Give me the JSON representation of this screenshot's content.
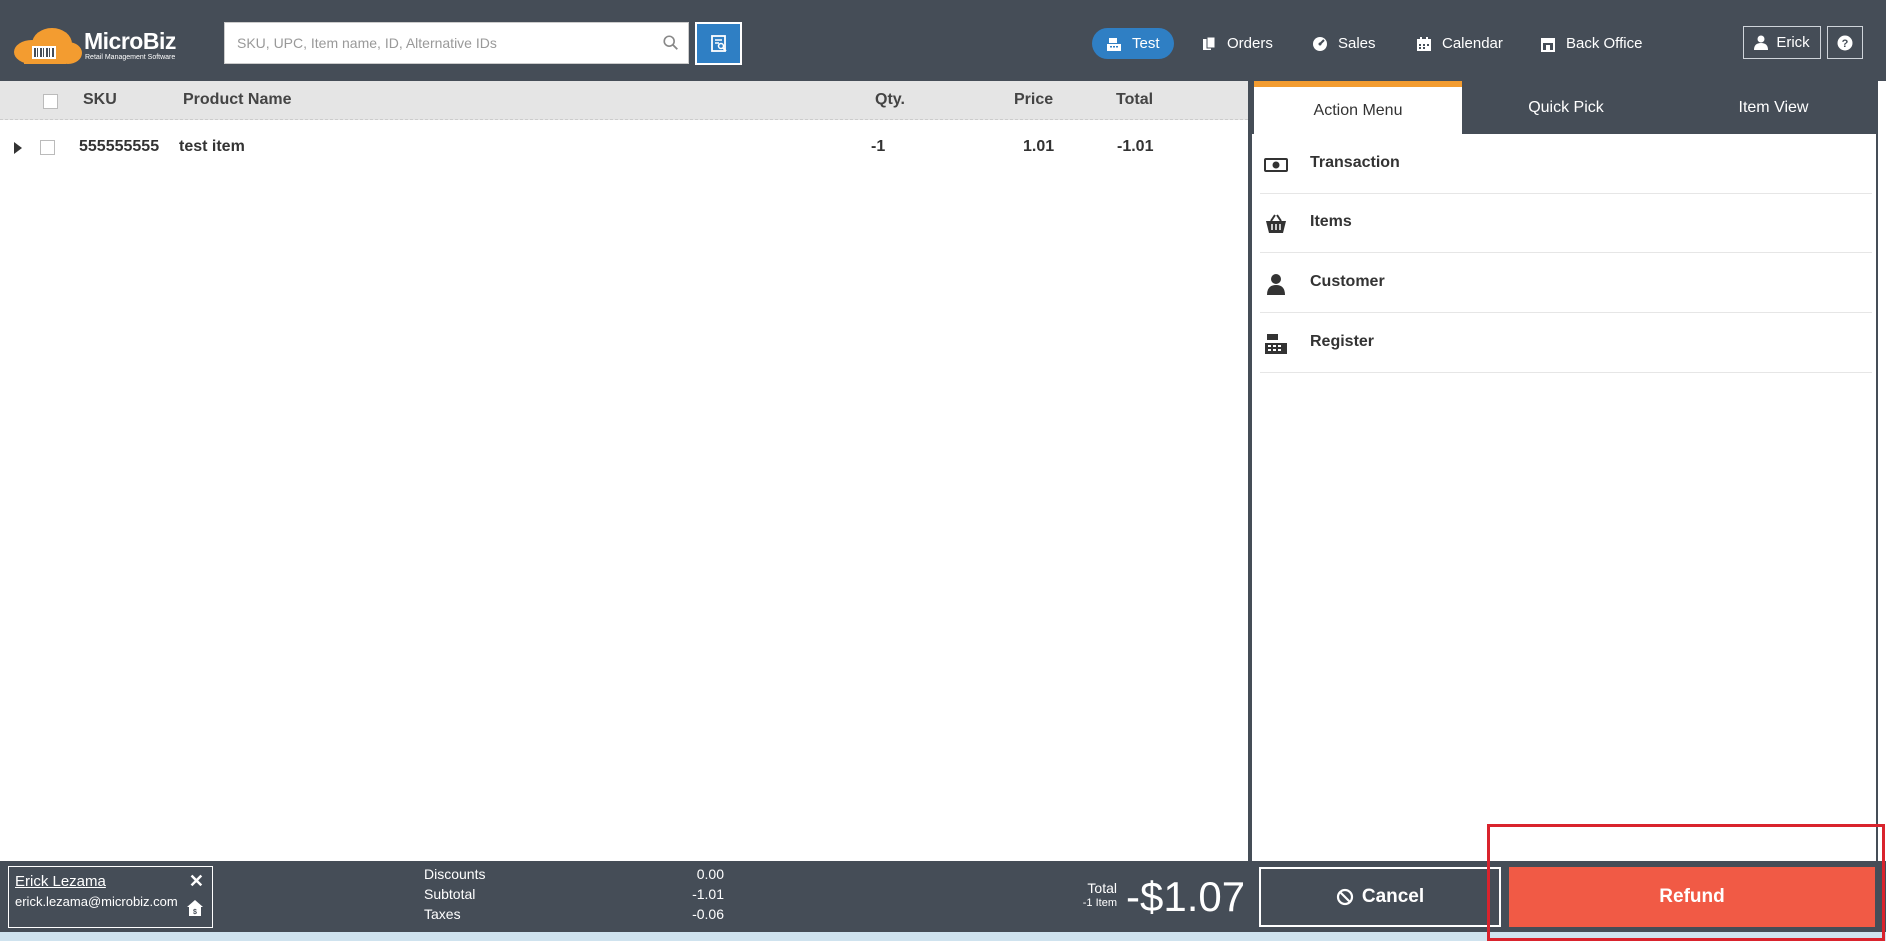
{
  "header": {
    "logo": {
      "name": "MicroBiz",
      "tagline": "Retail Management Software"
    },
    "search": {
      "placeholder": "SKU, UPC, Item name, ID, Alternative IDs",
      "value": ""
    },
    "nav": [
      {
        "label": "Test",
        "icon": "register-icon",
        "active": true
      },
      {
        "label": "Orders",
        "icon": "orders-icon"
      },
      {
        "label": "Sales",
        "icon": "sales-icon"
      },
      {
        "label": "Calendar",
        "icon": "calendar-icon"
      },
      {
        "label": "Back Office",
        "icon": "store-icon"
      }
    ],
    "user": {
      "name": "Erick"
    }
  },
  "table": {
    "columns": [
      "SKU",
      "Product Name",
      "Qty.",
      "Price",
      "Total"
    ],
    "rows": [
      {
        "sku": "555555555",
        "name": "test item",
        "qty": "-1",
        "price": "1.01",
        "total": "-1.01"
      }
    ]
  },
  "tabs": [
    "Action Menu",
    "Quick Pick",
    "Item View"
  ],
  "active_tab": "Action Menu",
  "action_menu": [
    {
      "label": "Transaction",
      "icon": "cash-icon"
    },
    {
      "label": "Items",
      "icon": "basket-icon"
    },
    {
      "label": "Customer",
      "icon": "person-icon"
    },
    {
      "label": "Register",
      "icon": "register-icon"
    }
  ],
  "customer": {
    "name": "Erick Lezama",
    "email": "erick.lezama@microbiz.com"
  },
  "summary": {
    "discounts_label": "Discounts",
    "discounts": "0.00",
    "subtotal_label": "Subtotal",
    "subtotal": "-1.01",
    "taxes_label": "Taxes",
    "taxes": "-0.06"
  },
  "total": {
    "label": "Total",
    "items": "-1 Item",
    "amount": "-$1.07"
  },
  "buttons": {
    "cancel": "Cancel",
    "refund": "Refund"
  },
  "colors": {
    "header_bg": "#454d57",
    "accent_blue": "#2f7fc4",
    "refund_red": "#f15a45",
    "tab_orange": "#f39c30",
    "highlight": "#d9232d"
  }
}
